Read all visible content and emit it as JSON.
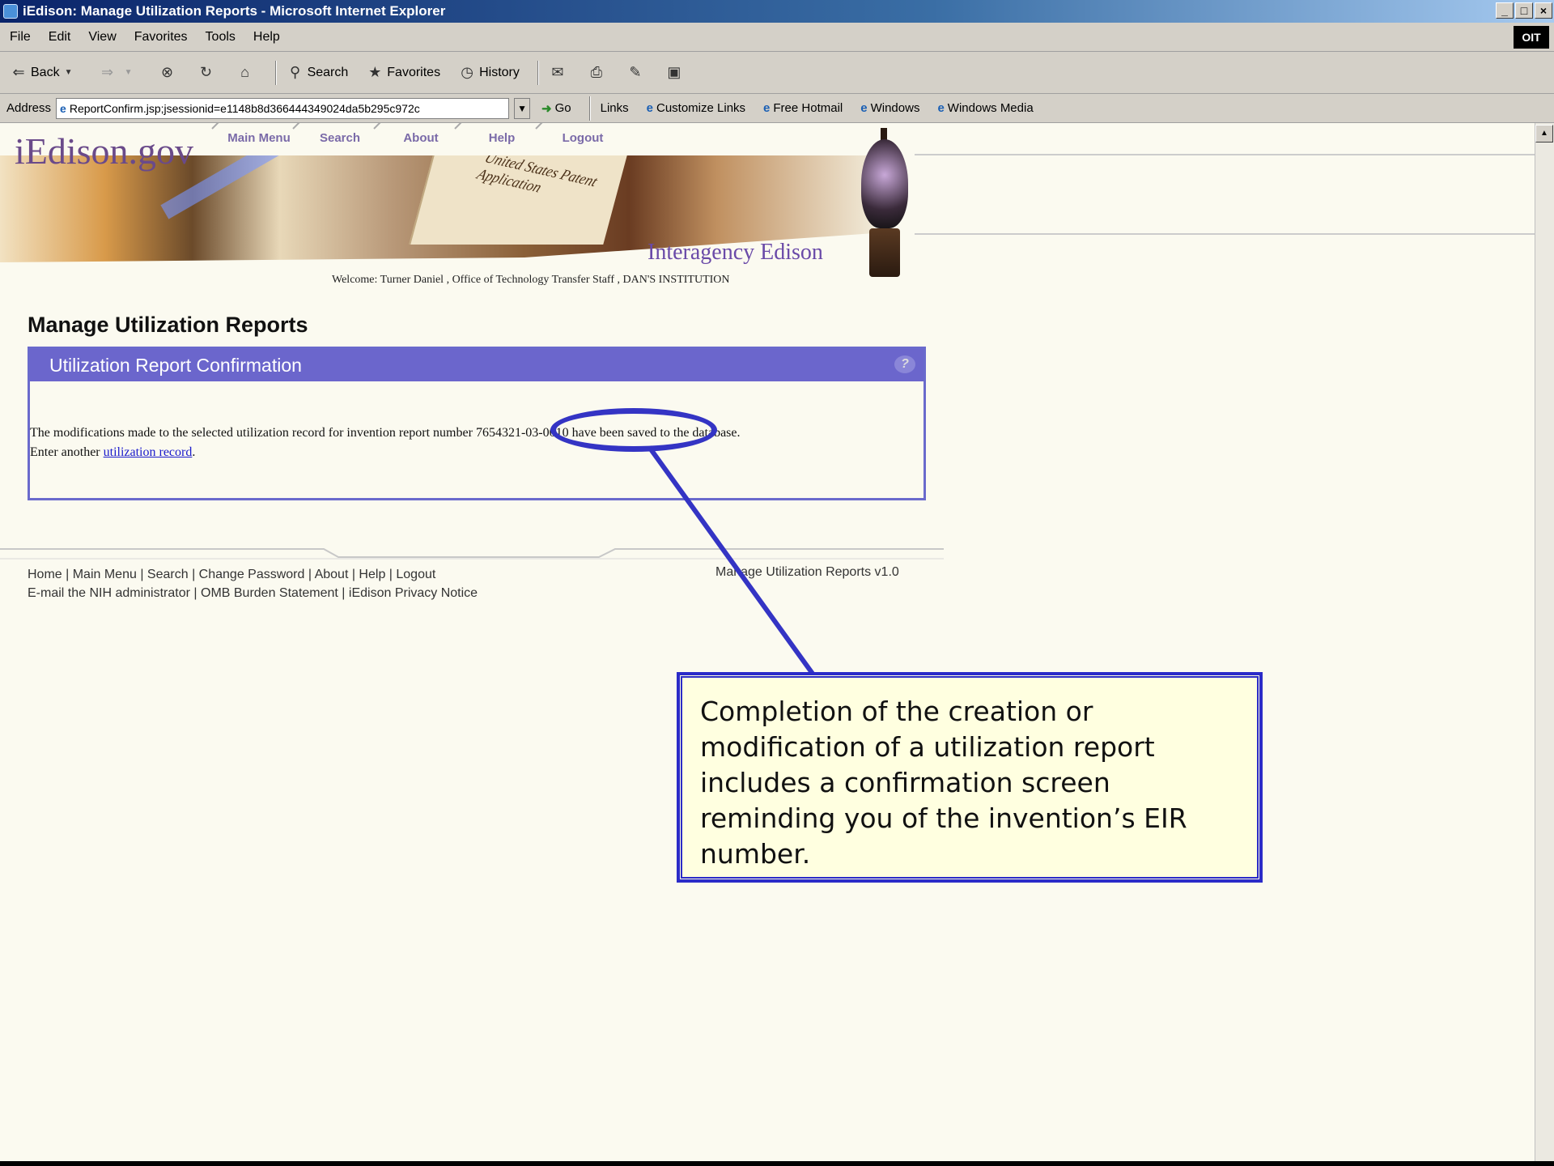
{
  "window": {
    "title": "iEdison: Manage Utilization Reports - Microsoft Internet Explorer",
    "controls": [
      "_",
      "□",
      "×"
    ]
  },
  "menubar": {
    "items": [
      "File",
      "Edit",
      "View",
      "Favorites",
      "Tools",
      "Help"
    ],
    "logo": "OIT"
  },
  "toolbar": {
    "back_label": "Back",
    "search_label": "Search",
    "favorites_label": "Favorites",
    "history_label": "History"
  },
  "addressbar": {
    "label": "Address",
    "url": "ReportConfirm.jsp;jsessionid=e1148b8d366444349024da5b295c972c",
    "go_label": "Go",
    "links_label": "Links",
    "links": [
      "Customize Links",
      "Free Hotmail",
      "Windows",
      "Windows Media"
    ]
  },
  "site": {
    "logo": "iEdison.gov",
    "nav": [
      "Main Menu",
      "Search",
      "About",
      "Help",
      "Logout"
    ],
    "banner_paper_text": "United States Patent Application",
    "tagline": "Interagency Edison",
    "welcome": "Welcome: Turner Daniel , Office of Technology Transfer Staff , DAN'S INSTITUTION"
  },
  "main": {
    "page_title": "Manage Utilization Reports",
    "panel_title": "Utilization Report Confirmation",
    "help_icon": "?",
    "message_before": "The modifications made to the selected utilization record for invention report number ",
    "report_number": "7654321-03-0010",
    "message_after": " have been saved to the database.",
    "enter_another": "Enter another ",
    "link_text": "utilization record",
    "period": "."
  },
  "footer": {
    "links_line1": "Home | Main Menu | Search | Change Password | About | Help | Logout",
    "links_line2": "E-mail the NIH administrator | OMB Burden Statement | iEdison Privacy Notice",
    "version": "Manage Utilization Reports v1.0"
  },
  "callout": {
    "text": "Completion of the creation or modification of a utilization report includes a confirmation screen reminding you of the invention’s EIR number."
  },
  "colors": {
    "panel_header": "#6b66cc",
    "callout_border": "#2b2bc8",
    "callout_bg": "#ffffe0",
    "page_bg": "#fbfaf0"
  }
}
